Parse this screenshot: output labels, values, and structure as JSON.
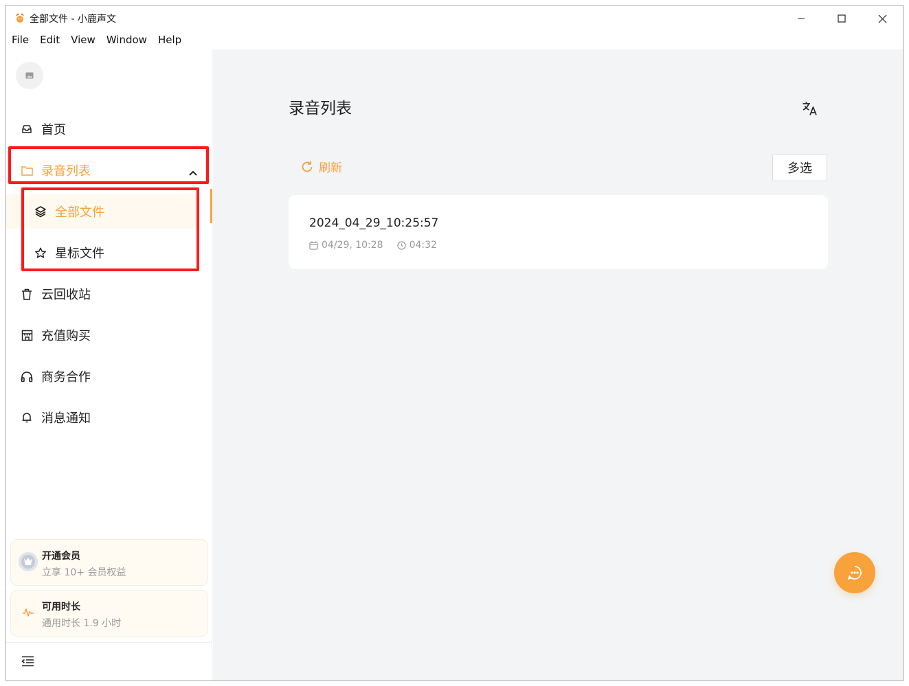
{
  "window": {
    "title": "全部文件 - 小鹿声文",
    "icon": "deer-app-icon",
    "controls": [
      "minimize-icon",
      "maximize-icon",
      "close-icon"
    ]
  },
  "menu": [
    "File",
    "Edit",
    "View",
    "Window",
    "Help"
  ],
  "sidebar": {
    "avatar_icon": "image-placeholder-icon",
    "items": [
      {
        "label": "首页",
        "icon": "inbox-icon"
      },
      {
        "label": "录音列表",
        "icon": "folder-icon",
        "expanded": true
      },
      {
        "label": "全部文件",
        "icon": "layers-icon",
        "active": true
      },
      {
        "label": "星标文件",
        "icon": "star-icon"
      },
      {
        "label": "云回收站",
        "icon": "trash-icon"
      },
      {
        "label": "充值购买",
        "icon": "store-icon"
      },
      {
        "label": "商务合作",
        "icon": "headphones-icon"
      },
      {
        "label": "消息通知",
        "icon": "bell-icon"
      }
    ],
    "promo_member": {
      "title": "开通会员",
      "subtitle": "立享 10+ 会员权益",
      "icon": "member-badge-icon"
    },
    "promo_time": {
      "title": "可用时长",
      "subtitle": "通用时长 1.9 小时",
      "icon": "waveform-icon"
    },
    "collapse_icon": "collapse-menu-icon"
  },
  "main": {
    "title": "录音列表",
    "translate_icon": "translate-icon",
    "refresh_label": "刷新",
    "multi_select_label": "多选",
    "files": [
      {
        "name": "2024_04_29_10:25:57",
        "date": "04/29, 10:28",
        "duration": "04:32"
      }
    ],
    "chat_icon": "chat-bubble-icon"
  },
  "colors": {
    "accent": "#f5a23c",
    "highlight": "#ff1a1a",
    "main_bg": "#f3f4f6"
  }
}
